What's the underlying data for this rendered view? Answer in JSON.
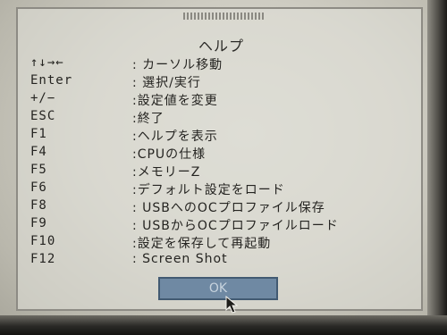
{
  "dialog": {
    "title": "ヘルプ",
    "ok_label": "OK"
  },
  "items": [
    {
      "key": "↑↓→←",
      "desc": ": カーソル移動"
    },
    {
      "key": "Enter",
      "desc": ": 選択/実行"
    },
    {
      "key": "+/−",
      "desc": ":設定値を変更"
    },
    {
      "key": "ESC",
      "desc": ":終了"
    },
    {
      "key": "F1",
      "desc": ":ヘルプを表示"
    },
    {
      "key": "F4",
      "desc": ":CPUの仕様"
    },
    {
      "key": "F5",
      "desc": ":メモリーZ"
    },
    {
      "key": "F6",
      "desc": ":デフォルト設定をロード"
    },
    {
      "key": "F8",
      "desc": ": USBへのOCプロファイル保存"
    },
    {
      "key": "F9",
      "desc": ": USBからOCプロファイルロード"
    },
    {
      "key": "F10",
      "desc": ":設定を保存して再起動"
    },
    {
      "key": "F12",
      "desc": ": Screen Shot"
    }
  ]
}
